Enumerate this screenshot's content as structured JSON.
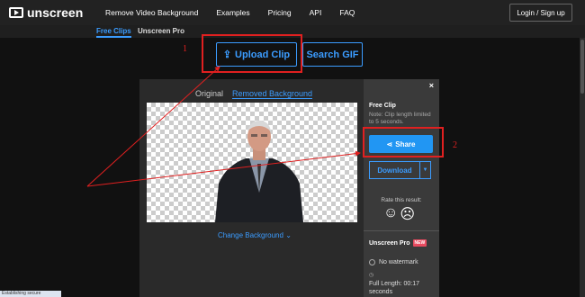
{
  "nav": {
    "logo_text": "unscreen",
    "menu": [
      "Remove Video Background",
      "Examples",
      "Pricing",
      "API",
      "FAQ"
    ],
    "login": "Login / Sign up"
  },
  "subnav": {
    "tabs": [
      "Free Clips",
      "Unscreen Pro"
    ],
    "active": "Free Clips"
  },
  "actions": {
    "upload": "Upload Clip",
    "search": "Search GIF"
  },
  "modal": {
    "tabs": [
      "Original",
      "Removed Background"
    ],
    "change_bg": "Change Background",
    "close": "×",
    "side": {
      "title": "Free Clip",
      "note": "Note: Clip length limited to 5 seconds.",
      "share": "Share",
      "download": "Download",
      "rate": "Rate this result:",
      "pro_title": "Unscreen Pro",
      "new_badge": "NEW",
      "no_watermark": "No watermark",
      "full_length": "Full Length: 00:17 seconds"
    }
  },
  "annotations": {
    "one": "1",
    "two": "2"
  },
  "status_text": "Establishing secure connection...",
  "colors": {
    "accent": "#3b9cff",
    "share_bg": "#2196f3",
    "annotation": "#e02020"
  }
}
